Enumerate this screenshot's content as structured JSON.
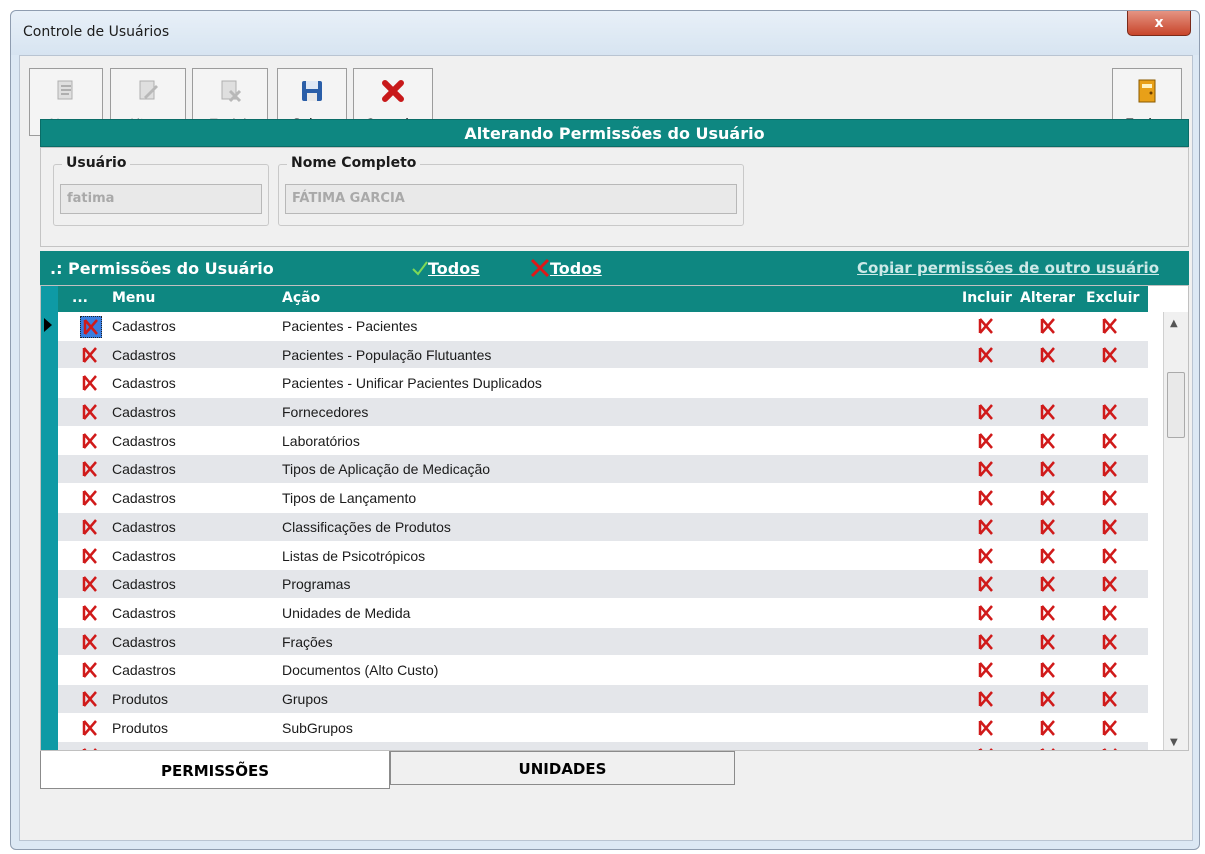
{
  "window": {
    "title": "Controle de Usuários",
    "close_glyph": "x"
  },
  "toolbar": {
    "novo": "Novo",
    "alterar": "Alterar",
    "excluir": "Excluir",
    "salvar": "Salvar",
    "cancelar": "Cancelar",
    "fechar": "Fechar"
  },
  "header": {
    "title": "Alterando Permissões do Usuário"
  },
  "fields": {
    "usuario_label": "Usuário",
    "usuario_value": "fatima",
    "nome_label": "Nome Completo",
    "nome_value": "FÁTIMA GARCIA"
  },
  "permissions": {
    "title": ".: Permissões do Usuário",
    "todos_check": "Todos",
    "todos_x": "Todos",
    "copy_link": "Copiar permissões de outro usuário",
    "columns": {
      "sel": "...",
      "menu": "Menu",
      "acao": "Ação",
      "incluir": "Incluir",
      "alterar": "Alterar",
      "excluir": "Excluir"
    },
    "rows": [
      {
        "menu": "Cadastros",
        "acao": "Pacientes - Pacientes",
        "crud": true
      },
      {
        "menu": "Cadastros",
        "acao": "Pacientes - População Flutuantes",
        "crud": true
      },
      {
        "menu": "Cadastros",
        "acao": "Pacientes - Unificar Pacientes Duplicados",
        "crud": false
      },
      {
        "menu": "Cadastros",
        "acao": "Fornecedores",
        "crud": true
      },
      {
        "menu": "Cadastros",
        "acao": "Laboratórios",
        "crud": true
      },
      {
        "menu": "Cadastros",
        "acao": "Tipos de Aplicação de Medicação",
        "crud": true
      },
      {
        "menu": "Cadastros",
        "acao": "Tipos de Lançamento",
        "crud": true
      },
      {
        "menu": "Cadastros",
        "acao": "Classificações de Produtos",
        "crud": true
      },
      {
        "menu": "Cadastros",
        "acao": "Listas de Psicotrópicos",
        "crud": true
      },
      {
        "menu": "Cadastros",
        "acao": "Programas",
        "crud": true
      },
      {
        "menu": "Cadastros",
        "acao": "Unidades de Medida",
        "crud": true
      },
      {
        "menu": "Cadastros",
        "acao": "Frações",
        "crud": true
      },
      {
        "menu": "Cadastros",
        "acao": "Documentos (Alto Custo)",
        "crud": true
      },
      {
        "menu": "Produtos",
        "acao": "Grupos",
        "crud": true
      },
      {
        "menu": "Produtos",
        "acao": "SubGrupos",
        "crud": true
      },
      {
        "menu": "Produtos",
        "acao": "Produtos",
        "crud": true
      }
    ]
  },
  "tabs": {
    "permissoes": "PERMISSÕES",
    "unidades": "UNIDADES"
  },
  "colors": {
    "teal": "#0e8781",
    "accent_red": "#d01a1a"
  }
}
